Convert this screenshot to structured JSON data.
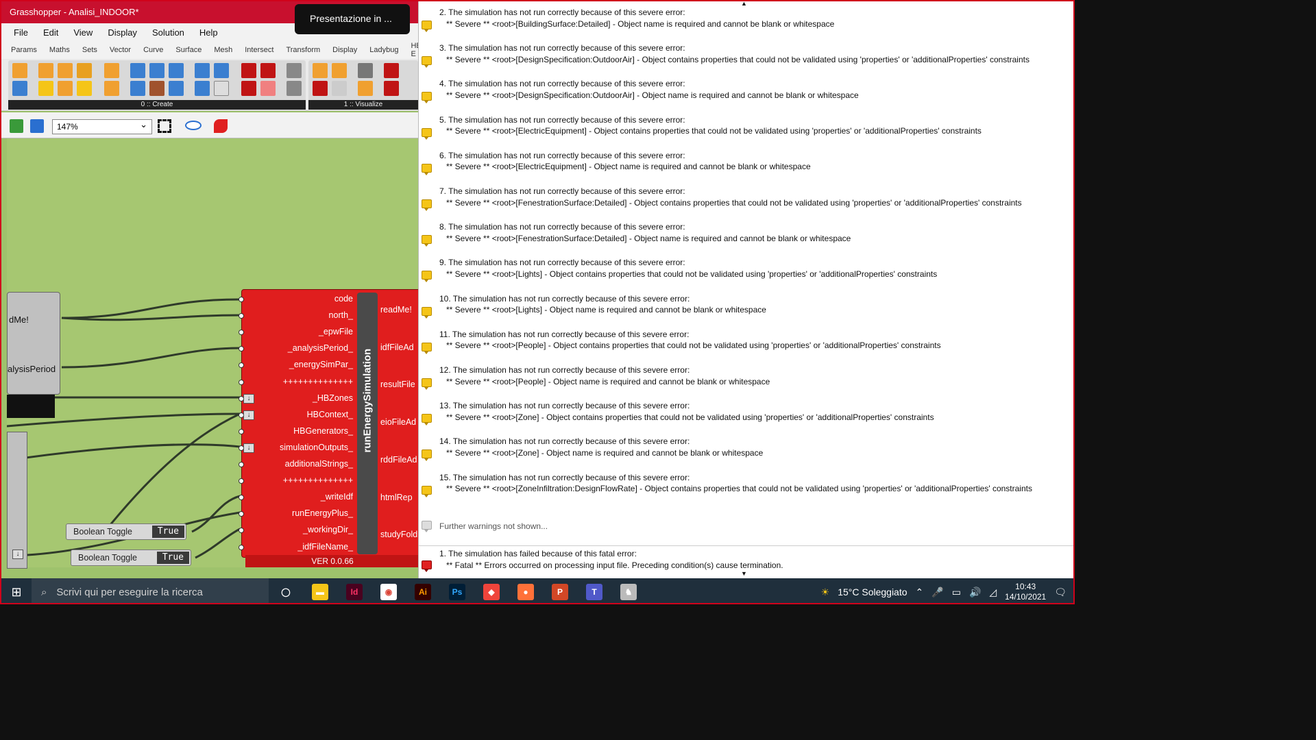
{
  "window": {
    "title": "Grasshopper - Analisi_INDOOR*"
  },
  "menu": [
    "File",
    "Edit",
    "View",
    "Display",
    "Solution",
    "Help"
  ],
  "tabs": [
    "Params",
    "Maths",
    "Sets",
    "Vector",
    "Curve",
    "Surface",
    "Mesh",
    "Intersect",
    "Transform",
    "Display",
    "Ladybug",
    "HB-E"
  ],
  "ribbon": {
    "group1_label": "0 :: Create",
    "group2_label": "1 :: Visualize"
  },
  "toolbar": {
    "zoom": "147%"
  },
  "presentation_popup": "Presentazione in ...",
  "canvas": {
    "left_node_outputs": [
      "dMe!",
      "alysisPeriod"
    ],
    "toggles": [
      {
        "label": "Boolean Toggle",
        "value": "True"
      },
      {
        "label": "Boolean Toggle",
        "value": "True"
      }
    ]
  },
  "component": {
    "name": "runEnergySimulation",
    "version": "VER 0.0.66",
    "inputs": [
      "code",
      "north_",
      "_epwFile",
      "_analysisPeriod_",
      "_energySimPar_",
      "++++++++++++++",
      "_HBZones",
      "HBContext_",
      "HBGenerators_",
      "simulationOutputs_",
      "additionalStrings_",
      "++++++++++++++",
      "_writeIdf",
      "runEnergyPlus_",
      "_workingDir_",
      "_idfFileName_"
    ],
    "outputs": [
      "readMe!",
      "idfFileAd",
      "resultFile",
      "eioFileAd",
      "rddFileAd",
      "htmlRep",
      "studyFold"
    ]
  },
  "messages": [
    {
      "line1": "2. The simulation has not run correctly because of this severe error:",
      "line2": "** Severe  ** <root>[BuildingSurface:Detailed] - Object name is required and cannot be blank or whitespace"
    },
    {
      "line1": "3. The simulation has not run correctly because of this severe error:",
      "line2": "** Severe  ** <root>[DesignSpecification:OutdoorAir] - Object contains properties that could not be validated using 'properties' or 'additionalProperties' constraints"
    },
    {
      "line1": "4. The simulation has not run correctly because of this severe error:",
      "line2": "** Severe  ** <root>[DesignSpecification:OutdoorAir] - Object name is required and cannot be blank or whitespace"
    },
    {
      "line1": "5. The simulation has not run correctly because of this severe error:",
      "line2": "** Severe  ** <root>[ElectricEquipment] - Object contains properties that could not be validated using 'properties' or 'additionalProperties' constraints"
    },
    {
      "line1": "6. The simulation has not run correctly because of this severe error:",
      "line2": "** Severe  ** <root>[ElectricEquipment] - Object name is required and cannot be blank or whitespace"
    },
    {
      "line1": "7. The simulation has not run correctly because of this severe error:",
      "line2": "** Severe  ** <root>[FenestrationSurface:Detailed] - Object contains properties that could not be validated using 'properties' or 'additionalProperties' constraints"
    },
    {
      "line1": "8. The simulation has not run correctly because of this severe error:",
      "line2": "** Severe  ** <root>[FenestrationSurface:Detailed] - Object name is required and cannot be blank or whitespace"
    },
    {
      "line1": "9. The simulation has not run correctly because of this severe error:",
      "line2": "** Severe  ** <root>[Lights] - Object contains properties that could not be validated using 'properties' or 'additionalProperties' constraints"
    },
    {
      "line1": "10. The simulation has not run correctly because of this severe error:",
      "line2": "** Severe  ** <root>[Lights] - Object name is required and cannot be blank or whitespace"
    },
    {
      "line1": "11. The simulation has not run correctly because of this severe error:",
      "line2": "** Severe  ** <root>[People] - Object contains properties that could not be validated using 'properties' or 'additionalProperties' constraints"
    },
    {
      "line1": "12. The simulation has not run correctly because of this severe error:",
      "line2": "** Severe  ** <root>[People] - Object name is required and cannot be blank or whitespace"
    },
    {
      "line1": "13. The simulation has not run correctly because of this severe error:",
      "line2": "** Severe  ** <root>[Zone] - Object contains properties that could not be validated using 'properties' or 'additionalProperties' constraints"
    },
    {
      "line1": "14. The simulation has not run correctly because of this severe error:",
      "line2": "** Severe  ** <root>[Zone] - Object name is required and cannot be blank or whitespace"
    },
    {
      "line1": "15. The simulation has not run correctly because of this severe error:",
      "line2": "** Severe  ** <root>[ZoneInfiltration:DesignFlowRate] - Object contains properties that could not be validated using 'properties' or 'additionalProperties' constraints"
    }
  ],
  "further_warnings": "Further warnings not shown...",
  "fatal": {
    "line1": "1. The simulation has failed because of this fatal error:",
    "line2": "**  Fatal  ** Errors occurred on processing input file. Preceding condition(s) cause termination."
  },
  "taskbar": {
    "search_placeholder": "Scrivi qui per eseguire la ricerca",
    "apps": [
      {
        "icon": "task-view-icon",
        "text": ""
      },
      {
        "icon": "file-explorer-icon",
        "text": ""
      },
      {
        "icon": "indesign-icon",
        "text": "Id",
        "color": "#ff3366"
      },
      {
        "icon": "chrome-icon",
        "text": ""
      },
      {
        "icon": "illustrator-icon",
        "text": "Ai",
        "color": "#ff9a00"
      },
      {
        "icon": "photoshop-icon",
        "text": "Ps",
        "color": "#31a8ff"
      },
      {
        "icon": "anydesk-icon",
        "text": ""
      },
      {
        "icon": "firefox-icon",
        "text": ""
      },
      {
        "icon": "powerpoint-icon",
        "text": "P"
      },
      {
        "icon": "teams-icon",
        "text": "T"
      },
      {
        "icon": "rhino-icon",
        "text": ""
      }
    ],
    "weather": "15°C  Soleggiato",
    "time": "10:43",
    "date": "14/10/2021"
  },
  "colors": {
    "accent": "#c8102e",
    "canvas": "#a6c771",
    "component": "#e01e1e",
    "taskbar": "#1f2f3c"
  }
}
